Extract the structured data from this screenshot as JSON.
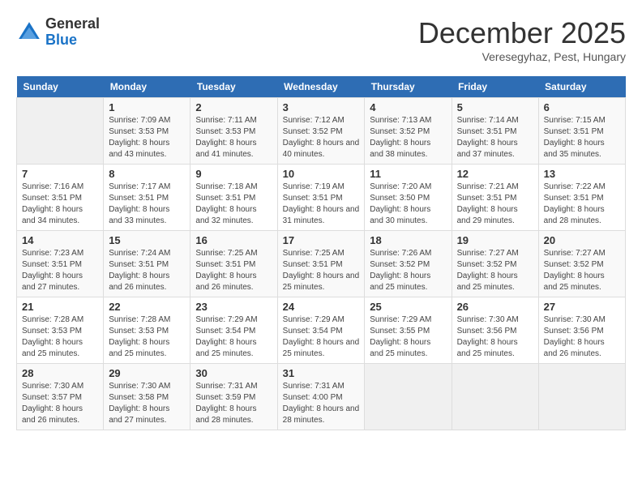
{
  "logo": {
    "general": "General",
    "blue": "Blue"
  },
  "header": {
    "month": "December 2025",
    "location": "Veresegyhaz, Pest, Hungary"
  },
  "weekdays": [
    "Sunday",
    "Monday",
    "Tuesday",
    "Wednesday",
    "Thursday",
    "Friday",
    "Saturday"
  ],
  "weeks": [
    [
      {
        "day": "",
        "sunrise": "",
        "sunset": "",
        "daylight": ""
      },
      {
        "day": "1",
        "sunrise": "7:09 AM",
        "sunset": "3:53 PM",
        "daylight": "8 hours and 43 minutes."
      },
      {
        "day": "2",
        "sunrise": "7:11 AM",
        "sunset": "3:53 PM",
        "daylight": "8 hours and 41 minutes."
      },
      {
        "day": "3",
        "sunrise": "7:12 AM",
        "sunset": "3:52 PM",
        "daylight": "8 hours and 40 minutes."
      },
      {
        "day": "4",
        "sunrise": "7:13 AM",
        "sunset": "3:52 PM",
        "daylight": "8 hours and 38 minutes."
      },
      {
        "day": "5",
        "sunrise": "7:14 AM",
        "sunset": "3:51 PM",
        "daylight": "8 hours and 37 minutes."
      },
      {
        "day": "6",
        "sunrise": "7:15 AM",
        "sunset": "3:51 PM",
        "daylight": "8 hours and 35 minutes."
      }
    ],
    [
      {
        "day": "7",
        "sunrise": "7:16 AM",
        "sunset": "3:51 PM",
        "daylight": "8 hours and 34 minutes."
      },
      {
        "day": "8",
        "sunrise": "7:17 AM",
        "sunset": "3:51 PM",
        "daylight": "8 hours and 33 minutes."
      },
      {
        "day": "9",
        "sunrise": "7:18 AM",
        "sunset": "3:51 PM",
        "daylight": "8 hours and 32 minutes."
      },
      {
        "day": "10",
        "sunrise": "7:19 AM",
        "sunset": "3:51 PM",
        "daylight": "8 hours and 31 minutes."
      },
      {
        "day": "11",
        "sunrise": "7:20 AM",
        "sunset": "3:50 PM",
        "daylight": "8 hours and 30 minutes."
      },
      {
        "day": "12",
        "sunrise": "7:21 AM",
        "sunset": "3:51 PM",
        "daylight": "8 hours and 29 minutes."
      },
      {
        "day": "13",
        "sunrise": "7:22 AM",
        "sunset": "3:51 PM",
        "daylight": "8 hours and 28 minutes."
      }
    ],
    [
      {
        "day": "14",
        "sunrise": "7:23 AM",
        "sunset": "3:51 PM",
        "daylight": "8 hours and 27 minutes."
      },
      {
        "day": "15",
        "sunrise": "7:24 AM",
        "sunset": "3:51 PM",
        "daylight": "8 hours and 26 minutes."
      },
      {
        "day": "16",
        "sunrise": "7:25 AM",
        "sunset": "3:51 PM",
        "daylight": "8 hours and 26 minutes."
      },
      {
        "day": "17",
        "sunrise": "7:25 AM",
        "sunset": "3:51 PM",
        "daylight": "8 hours and 25 minutes."
      },
      {
        "day": "18",
        "sunrise": "7:26 AM",
        "sunset": "3:52 PM",
        "daylight": "8 hours and 25 minutes."
      },
      {
        "day": "19",
        "sunrise": "7:27 AM",
        "sunset": "3:52 PM",
        "daylight": "8 hours and 25 minutes."
      },
      {
        "day": "20",
        "sunrise": "7:27 AM",
        "sunset": "3:52 PM",
        "daylight": "8 hours and 25 minutes."
      }
    ],
    [
      {
        "day": "21",
        "sunrise": "7:28 AM",
        "sunset": "3:53 PM",
        "daylight": "8 hours and 25 minutes."
      },
      {
        "day": "22",
        "sunrise": "7:28 AM",
        "sunset": "3:53 PM",
        "daylight": "8 hours and 25 minutes."
      },
      {
        "day": "23",
        "sunrise": "7:29 AM",
        "sunset": "3:54 PM",
        "daylight": "8 hours and 25 minutes."
      },
      {
        "day": "24",
        "sunrise": "7:29 AM",
        "sunset": "3:54 PM",
        "daylight": "8 hours and 25 minutes."
      },
      {
        "day": "25",
        "sunrise": "7:29 AM",
        "sunset": "3:55 PM",
        "daylight": "8 hours and 25 minutes."
      },
      {
        "day": "26",
        "sunrise": "7:30 AM",
        "sunset": "3:56 PM",
        "daylight": "8 hours and 25 minutes."
      },
      {
        "day": "27",
        "sunrise": "7:30 AM",
        "sunset": "3:56 PM",
        "daylight": "8 hours and 26 minutes."
      }
    ],
    [
      {
        "day": "28",
        "sunrise": "7:30 AM",
        "sunset": "3:57 PM",
        "daylight": "8 hours and 26 minutes."
      },
      {
        "day": "29",
        "sunrise": "7:30 AM",
        "sunset": "3:58 PM",
        "daylight": "8 hours and 27 minutes."
      },
      {
        "day": "30",
        "sunrise": "7:31 AM",
        "sunset": "3:59 PM",
        "daylight": "8 hours and 28 minutes."
      },
      {
        "day": "31",
        "sunrise": "7:31 AM",
        "sunset": "4:00 PM",
        "daylight": "8 hours and 28 minutes."
      },
      {
        "day": "",
        "sunrise": "",
        "sunset": "",
        "daylight": ""
      },
      {
        "day": "",
        "sunrise": "",
        "sunset": "",
        "daylight": ""
      },
      {
        "day": "",
        "sunrise": "",
        "sunset": "",
        "daylight": ""
      }
    ]
  ]
}
